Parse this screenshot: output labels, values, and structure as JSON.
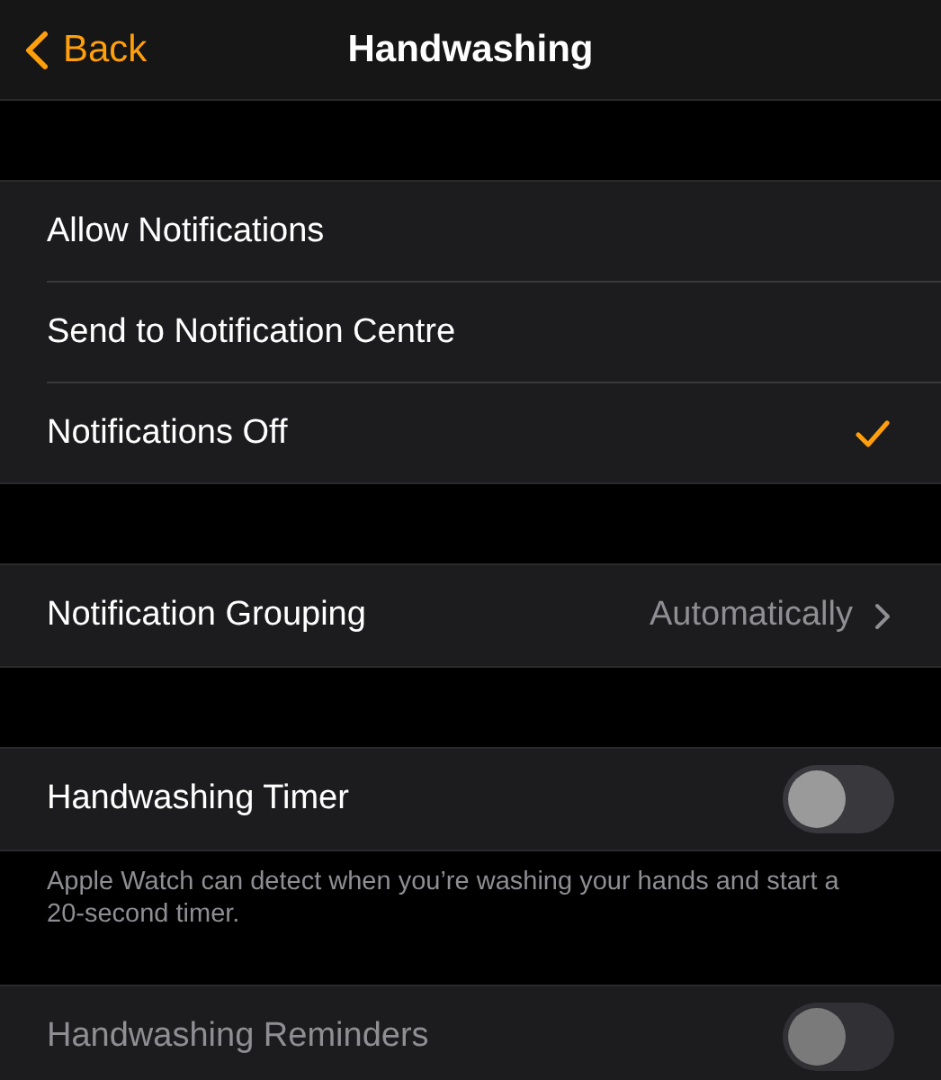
{
  "nav": {
    "back": "Back",
    "title": "Handwashing"
  },
  "notification_options": [
    {
      "label": "Allow Notifications",
      "selected": false
    },
    {
      "label": "Send to Notification Centre",
      "selected": false
    },
    {
      "label": "Notifications Off",
      "selected": true
    }
  ],
  "grouping": {
    "label": "Notification Grouping",
    "value": "Automatically"
  },
  "timer": {
    "label": "Handwashing Timer",
    "on": false,
    "disabled": false
  },
  "timer_footer": "Apple Watch can detect when you’re washing your hands and start a 20-second timer.",
  "reminders": {
    "label": "Handwashing Reminders",
    "on": false,
    "disabled": true
  }
}
